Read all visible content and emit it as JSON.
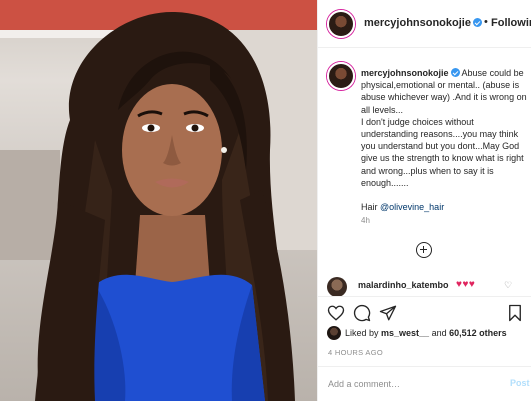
{
  "post": {
    "author": "mercyjohnsonokojie",
    "follow_separator": "•",
    "follow_label": "Following",
    "caption_text": "Abuse could be physical,emotional or mental.. (abuse is abuse whichever way) .And it is wrong on all levels...\nI don't judge choices without understanding reasons....you may think you understand but you dont...May God give us the strength to know what is right and wrong...plus when to say it is enough.......",
    "hair_prefix": "Hair ",
    "hair_mention": "@olivevine_hair",
    "caption_time": "4h",
    "comment": {
      "user": "malardinho_katembo",
      "text": "♥♥♥",
      "like_icon": "heart-outline-icon"
    },
    "likes": {
      "prefix": "Liked by ",
      "user": "ms_west__",
      "connector": " and ",
      "count": "60,512 others"
    },
    "posted_ago": "4 HOURS AGO",
    "add_comment_placeholder": "Add a comment…",
    "post_label": "Post"
  },
  "icons": {
    "like": "heart-outline-icon",
    "comment": "comment-bubble-icon",
    "share": "paper-plane-icon",
    "save": "bookmark-icon",
    "add": "plus-circle-icon",
    "verified": "verified-badge-icon"
  },
  "colors": {
    "verified_blue": "#3897f0",
    "link_blue": "#00376b",
    "post_button_disabled": "#b2dffc",
    "heart_red": "#e0245e",
    "dress_blue": "#1f4fd1"
  }
}
